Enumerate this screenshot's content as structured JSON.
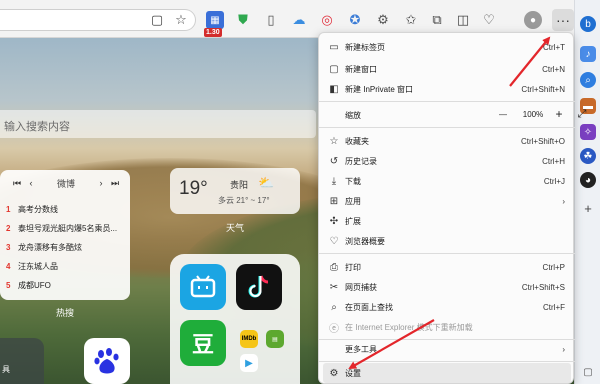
{
  "search": {
    "placeholder": "输入搜索内容"
  },
  "toolbar": {
    "badge": "1.30",
    "more_label": "···"
  },
  "hot": {
    "title": "微博",
    "items": [
      {
        "num": "1",
        "text": "高考分数线"
      },
      {
        "num": "2",
        "text": "泰坦号观光艇内爆5名乘员..."
      },
      {
        "num": "3",
        "text": "龙舟漂移有多酷炫"
      },
      {
        "num": "4",
        "text": "汪东城人品"
      },
      {
        "num": "5",
        "text": "成都UFO"
      }
    ],
    "caption": "热搜"
  },
  "weather": {
    "temp": "19°",
    "city": "贵阳",
    "condition": "多云 21° ~ 17°",
    "caption": "天气"
  },
  "tiles": {
    "left_label": "具"
  },
  "menu": {
    "items": [
      {
        "id": "new-tab",
        "icon": "new-tab-icon",
        "label": "新建标签页",
        "shortcut": "Ctrl+T"
      },
      {
        "id": "new-window",
        "icon": "window-icon",
        "label": "新建窗口",
        "shortcut": "Ctrl+N"
      },
      {
        "id": "inprivate",
        "icon": "inprivate-icon",
        "label": "新建 InPrivate 窗口",
        "shortcut": "Ctrl+Shift+N"
      },
      {
        "id": "zoom",
        "icon": "",
        "label": "缩放",
        "shortcut": ""
      },
      {
        "id": "favorites",
        "icon": "star-list-icon",
        "label": "收藏夹",
        "shortcut": "Ctrl+Shift+O"
      },
      {
        "id": "history",
        "icon": "history-icon",
        "label": "历史记录",
        "shortcut": "Ctrl+H"
      },
      {
        "id": "downloads",
        "icon": "download-icon",
        "label": "下载",
        "shortcut": "Ctrl+J"
      },
      {
        "id": "apps",
        "icon": "apps-icon",
        "label": "应用",
        "shortcut": "›"
      },
      {
        "id": "extensions",
        "icon": "extensions-icon",
        "label": "扩展",
        "shortcut": ""
      },
      {
        "id": "essentials",
        "icon": "heart-pulse-icon",
        "label": "浏览器概要",
        "shortcut": ""
      },
      {
        "id": "print",
        "icon": "print-icon",
        "label": "打印",
        "shortcut": "Ctrl+P"
      },
      {
        "id": "capture",
        "icon": "scissors-icon",
        "label": "网页捕获",
        "shortcut": "Ctrl+Shift+S"
      },
      {
        "id": "find",
        "icon": "find-icon",
        "label": "在页面上查找",
        "shortcut": "Ctrl+F"
      },
      {
        "id": "ie-mode",
        "icon": "ie-icon",
        "label": "在 Internet Explorer 模式下重新加载",
        "shortcut": ""
      },
      {
        "id": "more-tools",
        "icon": "",
        "label": "更多工具",
        "shortcut": "›"
      },
      {
        "id": "settings",
        "icon": "gear-icon",
        "label": "设置",
        "shortcut": ""
      }
    ],
    "zoom": {
      "minus": "—",
      "value": "100%",
      "plus": "+",
      "expand": "⤢"
    }
  }
}
